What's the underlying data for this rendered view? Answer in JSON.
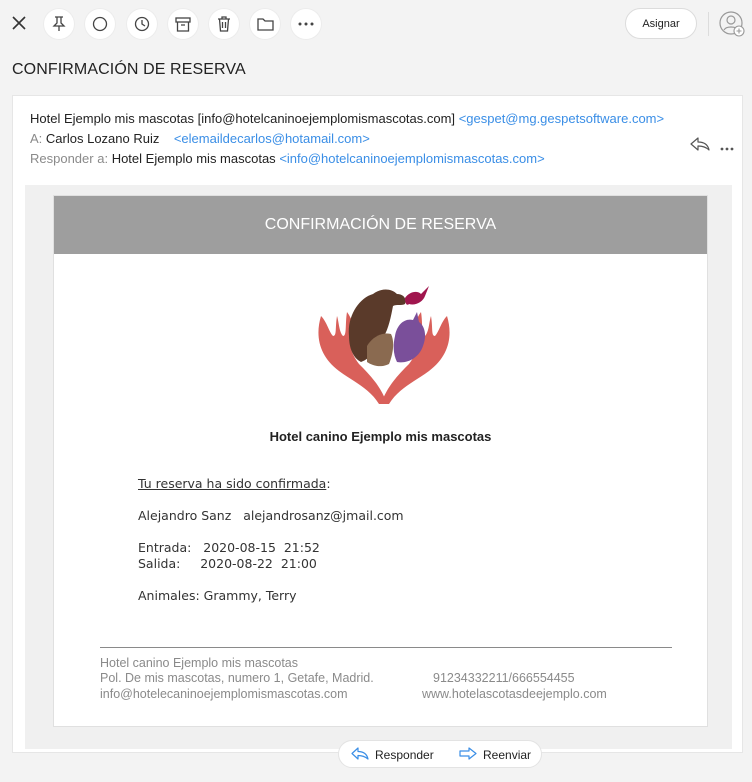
{
  "toolbar": {
    "assign_label": "Asignar",
    "icons": [
      "close-icon",
      "pin-icon",
      "circle-icon",
      "clock-icon",
      "archive-icon",
      "trash-icon",
      "folder-icon",
      "more-icon",
      "add-user-icon"
    ]
  },
  "page_title": "CONFIRMACIÓN DE RESERVA",
  "header": {
    "from_name": "Hotel Ejemplo mis mascotas",
    "from_bracket": "[info@hotelcaninoejemplomismascotas.com]",
    "from_addr": "<gespet@mg.gespetsoftware.com>",
    "to_label": "A:",
    "to_name": "Carlos Lozano Ruiz",
    "to_addr": "<elemaildecarlos@hotamail.com>",
    "reply_label": "Responder a:",
    "reply_name": "Hotel Ejemplo mis mascotas",
    "reply_addr": "<info@hotelcaninoejemplomismascotas.com>"
  },
  "mail": {
    "banner": "CONFIRMACIÓN DE RESERVA",
    "hotel_name": "Hotel canino Ejemplo mis mascotas",
    "confirm_text": "Tu reserva ha sido confirmada",
    "confirm_colon": ":",
    "guest_name": "Alejandro Sanz",
    "guest_email": "alejandrosanz@jmail.com",
    "entrada_label": "Entrada:",
    "entrada_value": "2020-08-15  21:52",
    "salida_label": "Salida:",
    "salida_value": "2020-08-22  21:00",
    "animals_label": "Animales:",
    "animals_value": "Grammy, Terry",
    "footer_name": "Hotel canino Ejemplo mis mascotas",
    "footer_address": "Pol. De mis mascotas, numero 1, Getafe, Madrid.",
    "footer_phones": "91234332211/666554455",
    "footer_email": "info@hotelecaninoejemplomismascotas.com",
    "footer_web": "www.hotelascotasdeejemplo.com"
  },
  "reply_bar": {
    "reply_label": "Responder",
    "forward_label": "Reenviar"
  },
  "colors": {
    "link_blue": "#3a8ee6",
    "banner_gray": "#9e9e9e",
    "hands_red": "#d9605a",
    "dog_brown": "#5a3a2a",
    "bird_magenta": "#a0164e",
    "cat_purple": "#7a4f9a"
  }
}
